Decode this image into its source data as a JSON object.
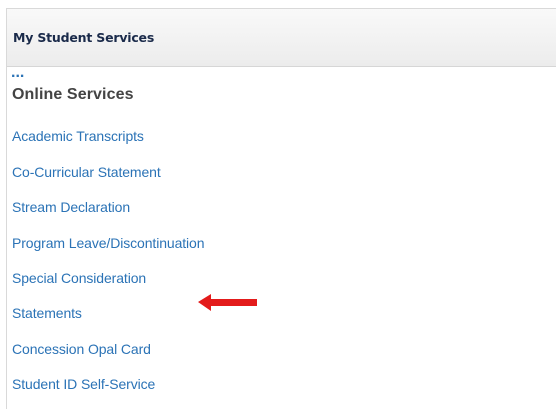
{
  "portlet": {
    "title": "My Student Services"
  },
  "section": {
    "ellipsis": "...",
    "heading": "Online Services",
    "links": [
      {
        "label": "Academic Transcripts"
      },
      {
        "label": "Co-Curricular Statement"
      },
      {
        "label": "Stream Declaration"
      },
      {
        "label": "Program Leave/Discontinuation"
      },
      {
        "label": "Special Consideration"
      },
      {
        "label": "Statements"
      },
      {
        "label": "Concession Opal Card"
      },
      {
        "label": "Student ID Self-Service"
      }
    ]
  },
  "annotation": {
    "arrow_color": "#e31b1b",
    "icon": "left-arrow-icon"
  },
  "colors": {
    "link": "#2b73b6",
    "heading": "#444444",
    "title": "#1a2a4a"
  }
}
